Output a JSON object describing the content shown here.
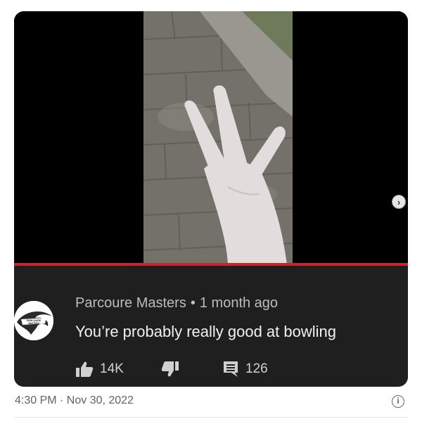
{
  "post": {
    "timestamp": "4:30 PM · Nov 30, 2022"
  },
  "video": {
    "next_icon": "chevron-right-icon",
    "progress_color": "#c8262a"
  },
  "comment": {
    "author": "Parcoure Masters",
    "separator": "•",
    "time_ago": "1 month ago",
    "text": "You’re probably really good at bowling",
    "likes": "14K",
    "replies": "126",
    "avatar_text": "PARCOURE MASTERS",
    "like_icon": "thumbs-up-icon",
    "dislike_icon": "thumbs-down-icon",
    "reply_icon": "comment-icon"
  },
  "colors": {
    "card_background": "#1f1f1f",
    "timestamp": "#5c6470"
  }
}
